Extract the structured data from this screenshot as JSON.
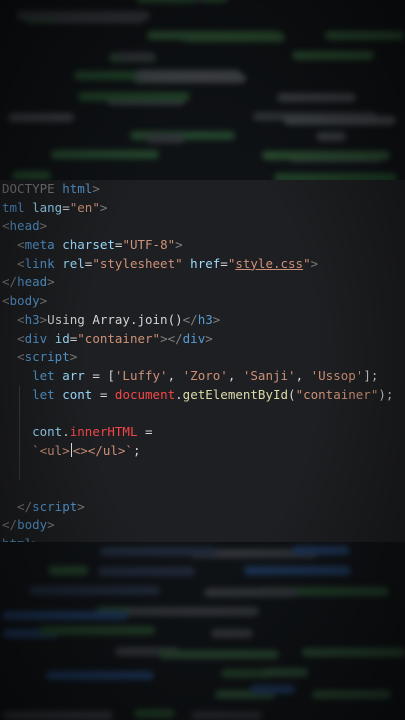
{
  "editor": {
    "lines": [
      [
        {
          "t": "DOCTYPE ",
          "c": "t-punc"
        },
        {
          "t": "html",
          "c": "t-tag"
        },
        {
          "t": ">",
          "c": "t-punc"
        }
      ],
      [
        {
          "t": "tml ",
          "c": "t-tag"
        },
        {
          "t": "lang",
          "c": "t-attr"
        },
        {
          "t": "=",
          "c": "t-text"
        },
        {
          "t": "\"en\"",
          "c": "t-str"
        },
        {
          "t": ">",
          "c": "t-punc"
        }
      ],
      [
        {
          "t": "<",
          "c": "t-punc"
        },
        {
          "t": "head",
          "c": "t-tag"
        },
        {
          "t": ">",
          "c": "t-punc"
        }
      ],
      [
        {
          "t": "  <",
          "c": "t-punc"
        },
        {
          "t": "meta ",
          "c": "t-tag"
        },
        {
          "t": "charset",
          "c": "t-attr"
        },
        {
          "t": "=",
          "c": "t-text"
        },
        {
          "t": "\"UTF-8\"",
          "c": "t-str"
        },
        {
          "t": ">",
          "c": "t-punc"
        }
      ],
      [
        {
          "t": "  <",
          "c": "t-punc"
        },
        {
          "t": "link ",
          "c": "t-tag"
        },
        {
          "t": "rel",
          "c": "t-attr"
        },
        {
          "t": "=",
          "c": "t-text"
        },
        {
          "t": "\"stylesheet\" ",
          "c": "t-str"
        },
        {
          "t": "href",
          "c": "t-attr"
        },
        {
          "t": "=",
          "c": "t-text"
        },
        {
          "t": "\"",
          "c": "t-str"
        },
        {
          "t": "style.css",
          "c": "t-str t-link"
        },
        {
          "t": "\"",
          "c": "t-str"
        },
        {
          "t": ">",
          "c": "t-punc"
        }
      ],
      [
        {
          "t": "</",
          "c": "t-punc"
        },
        {
          "t": "head",
          "c": "t-tag"
        },
        {
          "t": ">",
          "c": "t-punc"
        }
      ],
      [
        {
          "t": "<",
          "c": "t-punc"
        },
        {
          "t": "body",
          "c": "t-tag"
        },
        {
          "t": ">",
          "c": "t-punc"
        }
      ],
      [
        {
          "t": "  <",
          "c": "t-punc"
        },
        {
          "t": "h3",
          "c": "t-tag"
        },
        {
          "t": ">",
          "c": "t-punc"
        },
        {
          "t": "Using Array.join()",
          "c": "t-text"
        },
        {
          "t": "</",
          "c": "t-punc"
        },
        {
          "t": "h3",
          "c": "t-tag"
        },
        {
          "t": ">",
          "c": "t-punc"
        }
      ],
      [
        {
          "t": "  <",
          "c": "t-punc"
        },
        {
          "t": "div ",
          "c": "t-tag"
        },
        {
          "t": "id",
          "c": "t-attr"
        },
        {
          "t": "=",
          "c": "t-text"
        },
        {
          "t": "\"container\"",
          "c": "t-str"
        },
        {
          "t": "></",
          "c": "t-punc"
        },
        {
          "t": "div",
          "c": "t-tag"
        },
        {
          "t": ">",
          "c": "t-punc"
        }
      ],
      [
        {
          "t": "  <",
          "c": "t-punc"
        },
        {
          "t": "script",
          "c": "t-tag"
        },
        {
          "t": ">",
          "c": "t-punc"
        }
      ],
      [
        {
          "t": "    ",
          "c": "t-text"
        },
        {
          "t": "let ",
          "c": "t-kw"
        },
        {
          "t": "arr ",
          "c": "t-var"
        },
        {
          "t": "= [",
          "c": "t-text"
        },
        {
          "t": "'Luffy'",
          "c": "t-str"
        },
        {
          "t": ", ",
          "c": "t-text"
        },
        {
          "t": "'Zoro'",
          "c": "t-str"
        },
        {
          "t": ", ",
          "c": "t-text"
        },
        {
          "t": "'Sanji'",
          "c": "t-str"
        },
        {
          "t": ", ",
          "c": "t-text"
        },
        {
          "t": "'Ussop'",
          "c": "t-str"
        },
        {
          "t": "];",
          "c": "t-text"
        }
      ],
      [
        {
          "t": "    ",
          "c": "t-text"
        },
        {
          "t": "let ",
          "c": "t-kw"
        },
        {
          "t": "cont ",
          "c": "t-var"
        },
        {
          "t": "= ",
          "c": "t-text"
        },
        {
          "t": "document",
          "c": "t-obj"
        },
        {
          "t": ".",
          "c": "t-text"
        },
        {
          "t": "getElementById",
          "c": "t-fn"
        },
        {
          "t": "(",
          "c": "t-text"
        },
        {
          "t": "\"container\"",
          "c": "t-str"
        },
        {
          "t": ");",
          "c": "t-text"
        }
      ],
      [],
      [
        {
          "t": "    ",
          "c": "t-text"
        },
        {
          "t": "cont",
          "c": "t-var"
        },
        {
          "t": ".",
          "c": "t-text"
        },
        {
          "t": "innerHTML ",
          "c": "t-prop"
        },
        {
          "t": "=",
          "c": "t-text"
        }
      ],
      [
        {
          "t": "    ",
          "c": "t-text"
        },
        {
          "t": "`<ul>",
          "c": "t-tpl"
        },
        {
          "t": "|CARET|",
          "c": "caret"
        },
        {
          "t": "<></ul>`",
          "c": "t-tpl"
        },
        {
          "t": ";",
          "c": "t-text"
        }
      ],
      [],
      [],
      [
        {
          "t": "  </",
          "c": "t-punc"
        },
        {
          "t": "script",
          "c": "t-tag"
        },
        {
          "t": ">",
          "c": "t-punc"
        }
      ],
      [
        {
          "t": "</",
          "c": "t-punc"
        },
        {
          "t": "body",
          "c": "t-tag"
        },
        {
          "t": ">",
          "c": "t-punc"
        }
      ],
      [
        {
          "t": "html",
          "c": "t-tag"
        },
        {
          "t": ">",
          "c": "t-punc"
        }
      ]
    ]
  },
  "background": {
    "top_colors": [
      "#2f6b3a",
      "#3f7a45",
      "#5b5f66",
      "#6b6f74",
      "#356f41",
      "#4d5157"
    ],
    "bottom_colors": [
      "#274e86",
      "#3d3f45",
      "#2f5f37",
      "#4b4f56",
      "#3a6a44",
      "#2d3b55"
    ]
  }
}
